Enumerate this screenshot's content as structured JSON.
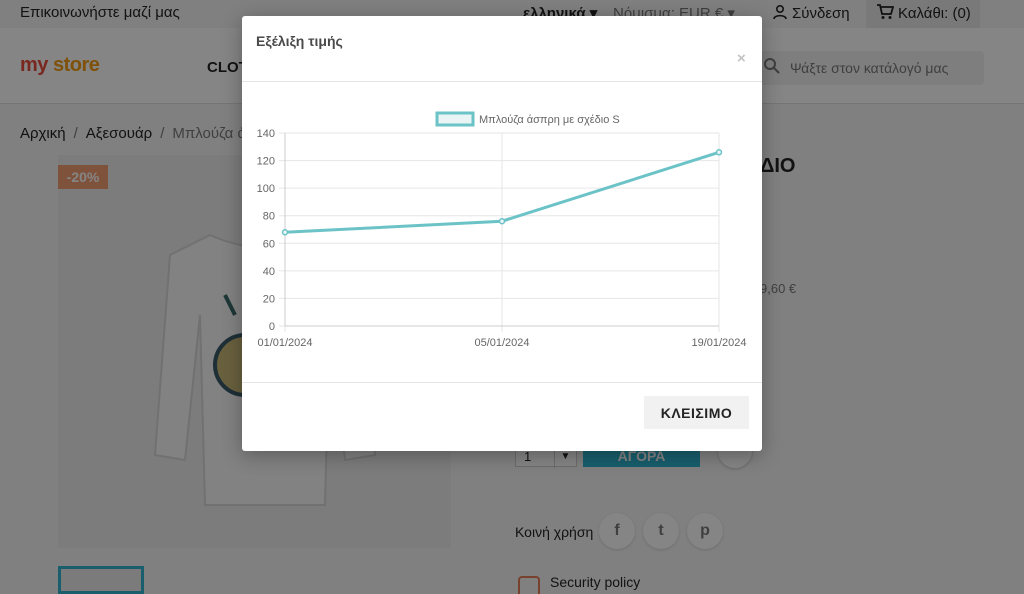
{
  "topbar": {
    "contact": "Επικοινωνήστε μαζί μας",
    "language": "ελληνικά ▾",
    "currency": "Νόμισμα: EUR € ▾",
    "login": "Σύνδεση",
    "cart": "Καλάθι: (0)"
  },
  "header": {
    "logo": {
      "m": "my",
      "s": "store"
    },
    "nav_item": "CLOT",
    "search_placeholder": "Ψάξτε στον κατάλογό μας"
  },
  "breadcrumb": [
    "Αρχική",
    "Αξεσουάρ",
    "Μπλούζα ά"
  ],
  "product": {
    "discount_badge": "-20%",
    "title_fragment": "ΔΙΟ",
    "price_fragment": "9,60 €",
    "quantity": "1",
    "add_to_cart": "ΑΓΟΡΑ",
    "share_label": "Κοινή χρήση",
    "share_icons": [
      "f",
      "t",
      "p"
    ],
    "security": "Security policy"
  },
  "modal": {
    "title": "Εξέλιξη τιμής",
    "close_x": "×",
    "close_button": "ΚΛΕΙΣΙΜΟ"
  },
  "chart_data": {
    "type": "line",
    "x": [
      "01/01/2024",
      "05/01/2024",
      "19/01/2024"
    ],
    "series": [
      {
        "name": "Μπλούζα άσπρη με σχέδιο S",
        "values": [
          68,
          76,
          126
        ]
      }
    ],
    "ylim": [
      0,
      140
    ],
    "yticks": [
      0,
      20,
      40,
      60,
      80,
      100,
      120,
      140
    ],
    "grid": true,
    "legend": "top-center",
    "color": "#6cc3c7"
  }
}
